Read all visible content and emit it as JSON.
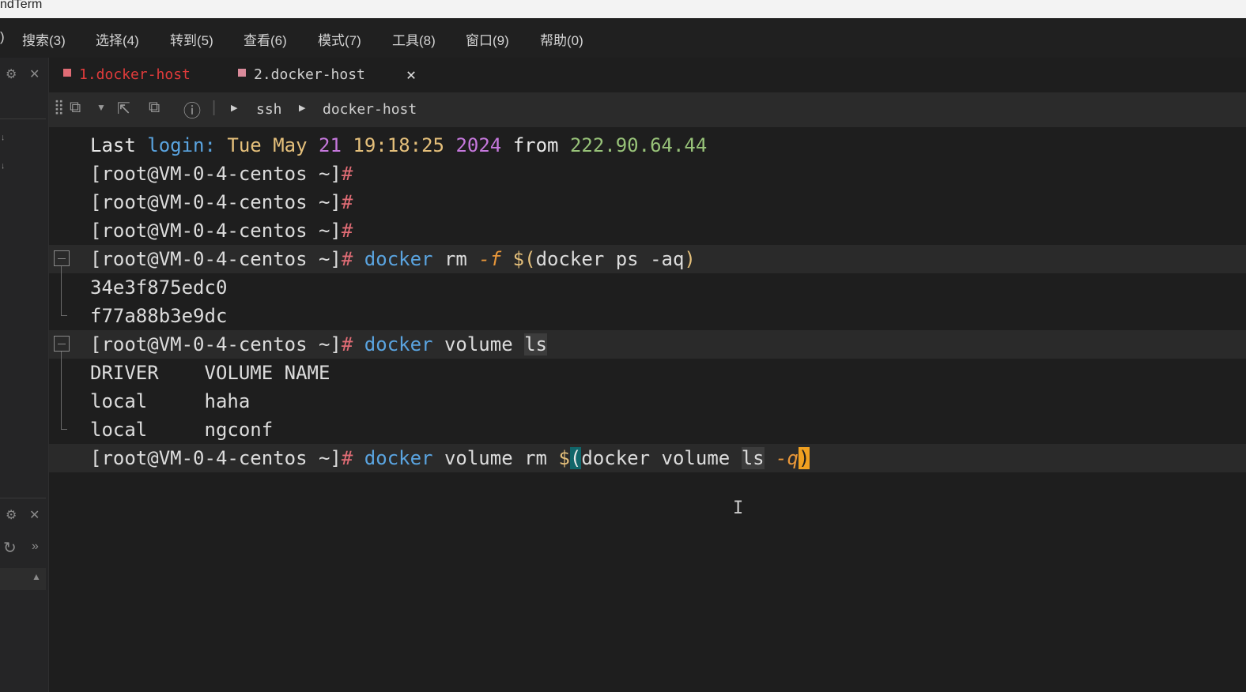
{
  "window": {
    "title": "ndTerm"
  },
  "menu": [
    "搜索(3)",
    "选择(4)",
    "转到(5)",
    "查看(6)",
    "模式(7)",
    "工具(8)",
    "窗口(9)",
    "帮助(0)"
  ],
  "tabs": [
    {
      "label": "1.docker-host",
      "active": false,
      "color": "#e03b3b"
    },
    {
      "label": "2.docker-host",
      "active": true,
      "color": "#cfcfcf"
    }
  ],
  "breadcrumb": [
    "ssh",
    "docker-host"
  ],
  "terminal": {
    "last_login": {
      "word1": "Last",
      "word2": "login:",
      "day": "Tue",
      "month": "May",
      "date": "21",
      "time": "19:18:25",
      "year": "2024",
      "from": "from",
      "ip": "222.90.64.44"
    },
    "prompt": "[root@VM-0-4-centos ~]",
    "hash": "#",
    "cmd1": {
      "docker": "docker",
      "rm": "rm",
      "flag": "-f",
      "dollar": "$(",
      "inner": "docker ps -aq",
      "close": ")"
    },
    "out1": [
      "34e3f875edc0",
      "f77a88b3e9dc"
    ],
    "cmd2": {
      "docker": "docker",
      "volume": "volume",
      "ls": "ls"
    },
    "table_header": {
      "driver": "DRIVER",
      "volume_name": "VOLUME NAME"
    },
    "volumes": [
      {
        "driver": "local",
        "name": "haha"
      },
      {
        "driver": "local",
        "name": "ngconf"
      }
    ],
    "cmd3": {
      "docker": "docker",
      "volume": "volume",
      "rm": "rm",
      "dollar": "$",
      "open": "(",
      "inner_docker": "docker",
      "inner_volume": "volume",
      "inner_ls": "ls",
      "flag": "-q",
      "close": ")"
    }
  }
}
